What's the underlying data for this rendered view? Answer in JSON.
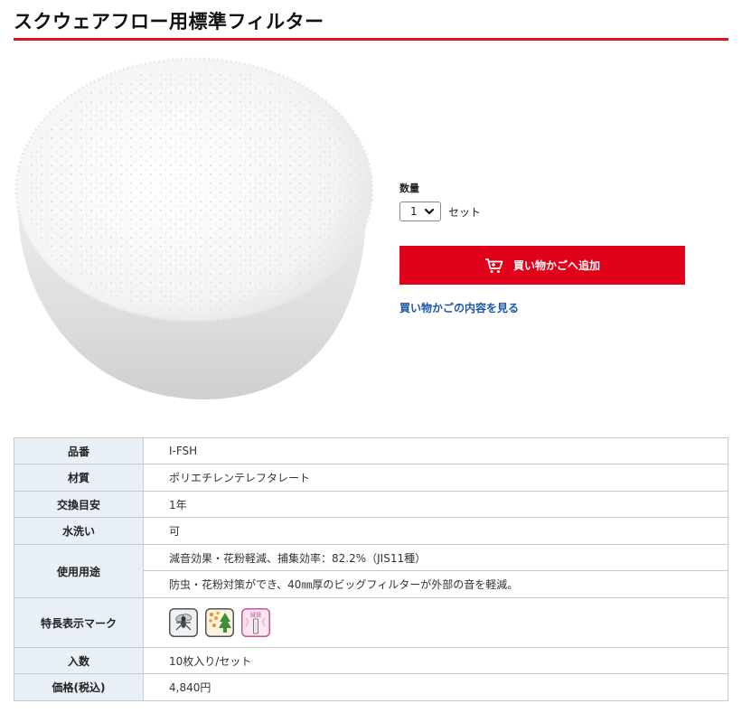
{
  "page": {
    "title": "スクウェアフロー用標準フィルター"
  },
  "purchase": {
    "quantity_label": "数量",
    "quantity_value": "1",
    "unit": "セット",
    "add_to_cart_label": "買い物かごへ追加",
    "view_cart_label": "買い物かごの内容を見る"
  },
  "specs": {
    "part_number": {
      "label": "品番",
      "value": "I-FSH"
    },
    "material": {
      "label": "材質",
      "value": "ポリエチレンテレフタレート"
    },
    "replacement": {
      "label": "交換目安",
      "value": "1年"
    },
    "washable": {
      "label": "水洗い",
      "value": "可"
    },
    "usage": {
      "label": "使用用途",
      "values": [
        "減音効果・花粉軽減、捕集効率：82.2%（JIS11種）",
        "防虫・花粉対策ができ、40㎜厚のビッグフィルターが外部の音を軽減。"
      ]
    },
    "feature_marks": {
      "label": "特長表示マーク",
      "icons": [
        "insect-repellent-mark-icon",
        "pollen-tree-mark-icon",
        "sound-reduction-mark-icon"
      ],
      "sound_mark_text": "減音"
    },
    "quantity_per": {
      "label": "入数",
      "value": "10枚入り/セット"
    },
    "price": {
      "label": "価格(税込)",
      "value": "4,840円"
    }
  },
  "colors": {
    "accent_red": "#e0001a",
    "title_rule": "#d7152a",
    "link_blue": "#1a56a6",
    "table_header_bg": "#e8eff7"
  }
}
